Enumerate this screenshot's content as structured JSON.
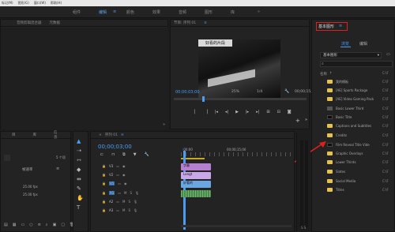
{
  "menubar": {
    "items": [
      "标记(M)",
      "图形(G)",
      "窗口(W)",
      "帮助(H)"
    ]
  },
  "workspace": {
    "tabs": [
      "组件",
      "编辑",
      "颜色",
      "效果",
      "音频",
      "图形",
      "库"
    ],
    "active_index": 1,
    "more": "»",
    "menu_glyph": "≡"
  },
  "source_panel": {
    "tabs": [
      "音频剪辑混合器",
      "元数据"
    ],
    "menu": "»"
  },
  "program": {
    "title": "节目: 序列 01",
    "menu": "≡",
    "video_caption": "好看的片段",
    "timecode": "00;00;03;00",
    "zoom": "25%",
    "resolution": "1/4",
    "end_timecode": "00;00;15;00"
  },
  "graphics": {
    "header": "基本图形",
    "menu": "≡",
    "tabs": [
      "浏览",
      "编辑"
    ],
    "active_tab": 0,
    "dropdown": "基本图形",
    "search_icon_text": "",
    "col_name": "名称",
    "col_sort": "↑",
    "col_cf": "C:\\F",
    "items": [
      {
        "label": "我的模板",
        "icon": "folder"
      },
      {
        "label": "[AE] Sports Package",
        "icon": "folder"
      },
      {
        "label": "[AE] Video Gaming Pack",
        "icon": "folder"
      },
      {
        "label": "Basic Lower Third",
        "icon": "gray"
      },
      {
        "label": "Basic Title",
        "icon": "black"
      },
      {
        "label": "Captions and Subtitles",
        "icon": "folder"
      },
      {
        "label": "Credits",
        "icon": "folder"
      },
      {
        "label": "Film Reveal Title Vide",
        "icon": "black"
      },
      {
        "label": "Graphic Overlays",
        "icon": "folder"
      },
      {
        "label": "Lower Thirds",
        "icon": "folder"
      },
      {
        "label": "Slates",
        "icon": "folder"
      },
      {
        "label": "Social Media",
        "icon": "folder"
      },
      {
        "label": "Titles",
        "icon": "folder"
      }
    ]
  },
  "project": {
    "tabs": [
      "目",
      "库",
      "信息"
    ],
    "menu": "»",
    "count": "5 个项",
    "col_fps": "帧速率",
    "rows": [
      {
        "fps": "25.00 fps"
      },
      {
        "fps": "25.00 fps"
      }
    ]
  },
  "timeline": {
    "title": "序列 01",
    "menu": "≡",
    "timecode": "00;00;03;00",
    "ruler_start": ":00:00",
    "ruler_end": "00;00;15;00",
    "tracks": [
      {
        "name": "V3"
      },
      {
        "name": "V2"
      },
      {
        "name": "V1"
      },
      {
        "name": "A1",
        "m": "M",
        "s": "S"
      },
      {
        "name": "A2",
        "m": "M",
        "s": "S"
      },
      {
        "name": "A3",
        "m": "M",
        "s": "S"
      }
    ],
    "clip_v3": "字幕",
    "clip_v2": "Longt",
    "clip_v1": "好看的",
    "clip_a1": "",
    "audio_label": "S S"
  },
  "colors": {
    "accent": "#4b9cf5",
    "highlight_red": "#e02020",
    "v3_clip": "#b77fd0",
    "v2_clip": "#c8a8e8",
    "v1_clip": "#6aa6e0",
    "audio_clip": "#4a8a4a"
  }
}
